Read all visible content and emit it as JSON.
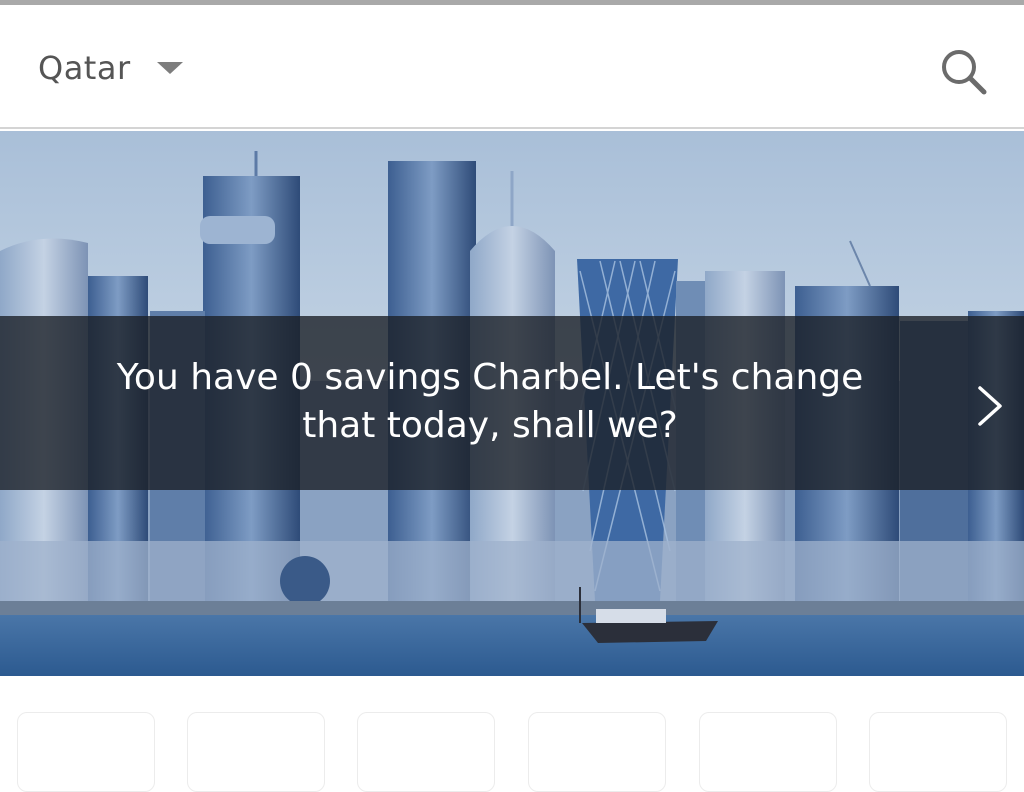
{
  "header": {
    "country": "Qatar",
    "caret_icon": "caret-down-icon",
    "search_icon": "search-icon"
  },
  "hero": {
    "image": "doha-skyline-photo",
    "banner_text": "You have 0 savings Charbel. Let's change that today, shall we?",
    "next_icon": "chevron-right-icon"
  },
  "cards": [
    {
      "id": "card-1"
    },
    {
      "id": "card-2"
    },
    {
      "id": "card-3"
    },
    {
      "id": "card-4"
    },
    {
      "id": "card-5"
    },
    {
      "id": "card-6"
    }
  ],
  "colors": {
    "header_text": "#555555",
    "banner_overlay": "#1c2128",
    "water": "#2f5c92"
  }
}
